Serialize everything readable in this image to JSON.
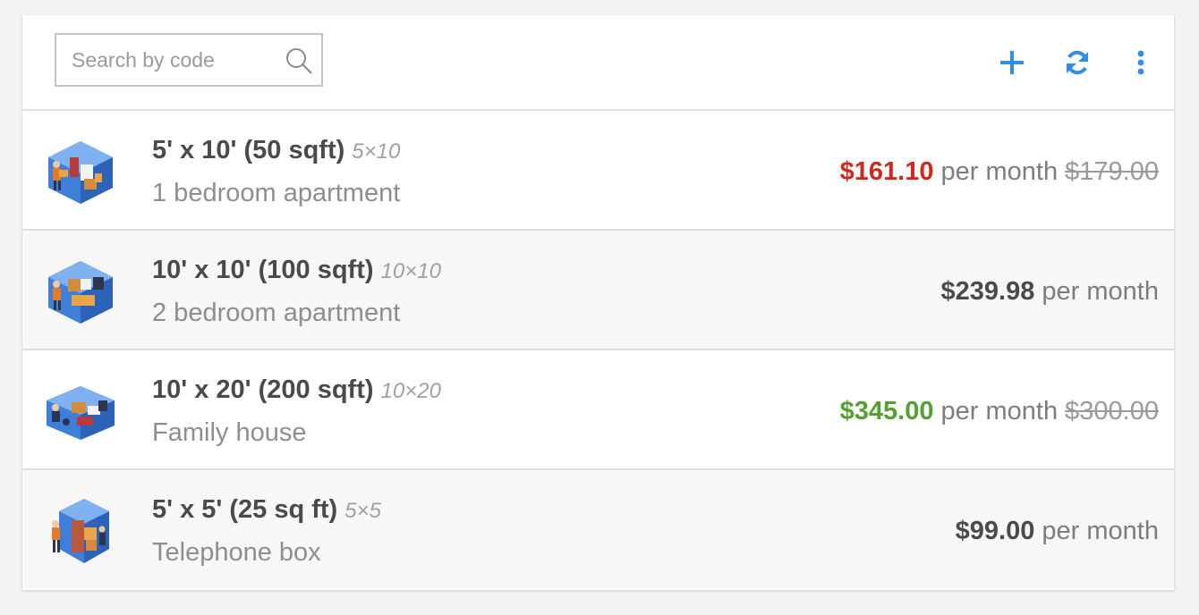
{
  "search": {
    "placeholder": "Search by code"
  },
  "toolbar": {
    "icons": [
      "plus-icon",
      "refresh-icon",
      "more-vertical-icon"
    ],
    "icon_color": "#2f8ee6"
  },
  "colors": {
    "price_discount": "#cc2a1e",
    "price_increase": "#55a032",
    "price_default": "#4a4a4a"
  },
  "units": [
    {
      "title": "5' x 10' (50 sqft)",
      "code": "5×10",
      "subtitle": "1 bedroom apartment",
      "price": "$161.10",
      "per": "per month",
      "old_price": "$179.00",
      "price_color": "#cc2a1e"
    },
    {
      "title": "10' x 10' (100 sqft)",
      "code": "10×10",
      "subtitle": "2 bedroom apartment",
      "price": "$239.98",
      "per": "per month",
      "old_price": "",
      "price_color": "#4a4a4a"
    },
    {
      "title": "10' x 20' (200 sqft)",
      "code": "10×20",
      "subtitle": "Family house",
      "price": "$345.00",
      "per": "per month",
      "old_price": "$300.00",
      "price_color": "#55a032"
    },
    {
      "title": "5' x 5' (25 sq ft)",
      "code": "5×5",
      "subtitle": "Telephone box",
      "price": "$99.00",
      "per": "per month",
      "old_price": "",
      "price_color": "#4a4a4a"
    }
  ]
}
